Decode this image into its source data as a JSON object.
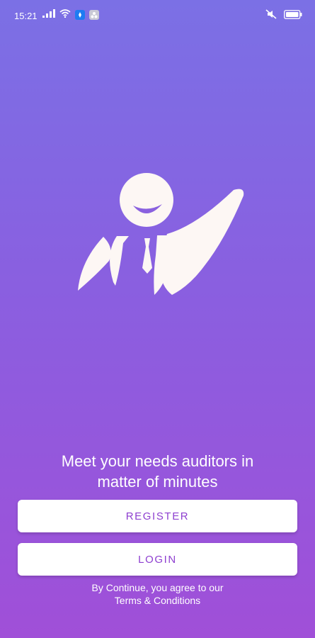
{
  "status_bar": {
    "time": "15:21",
    "icons": [
      "cellular-signal-icon",
      "wifi-icon",
      "app-notification-icon",
      "app-notification-icon-2",
      "mute-icon",
      "battery-icon"
    ],
    "colors": {
      "badge_blue": "#1e7cf2",
      "badge_gray": "#c9c9d6"
    }
  },
  "hero": {
    "logo": "auditor-person-logo"
  },
  "tagline": {
    "line1": "Meet your needs auditors in",
    "line2": "matter of minutes"
  },
  "buttons": {
    "register_label": "REGISTER",
    "login_label": "LOGIN"
  },
  "terms": {
    "line1": "By Continue, you agree to our",
    "link": "Terms & Conditions"
  },
  "colors": {
    "gradient_top": "#7b70e5",
    "gradient_bottom": "#a04fd8",
    "button_text": "#8e3fd0",
    "logo_fill": "#fdf7f4"
  }
}
